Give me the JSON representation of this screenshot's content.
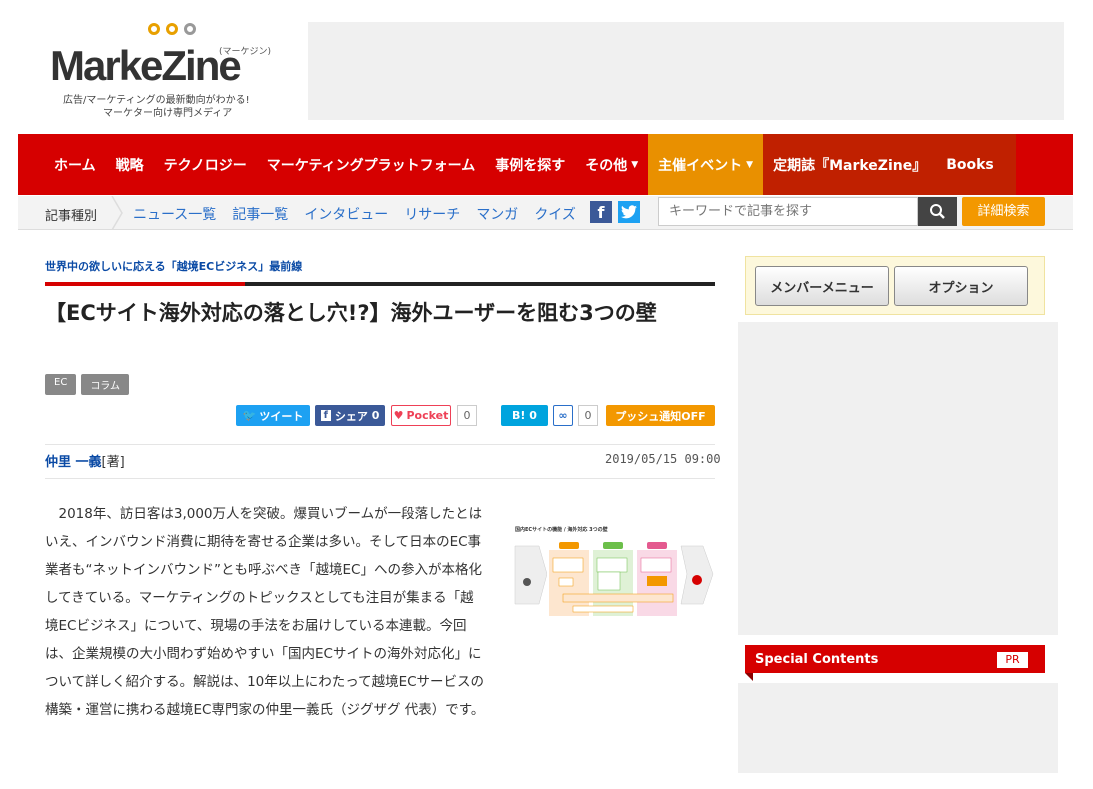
{
  "logo": {
    "main": "MarkeZine",
    "kana": "(マーケジン)",
    "tagline1": "広告/マーケティングの最新動向がわかる!",
    "tagline2": "マーケター向け専門メディア"
  },
  "nav": {
    "items": [
      "ホーム",
      "戦略",
      "テクノロジー",
      "マーケティングプラットフォーム",
      "事例を探す",
      "その他",
      "主催イベント",
      "定期誌『MarkeZine』",
      "Books"
    ]
  },
  "subnav": {
    "label": "記事種別",
    "links": [
      "ニュース一覧",
      "記事一覧",
      "インタビュー",
      "リサーチ",
      "マンガ",
      "クイズ"
    ],
    "search_placeholder": "キーワードで記事を探す",
    "advanced_search": "詳細検索"
  },
  "article": {
    "series": "世界中の欲しいに応える「越境ECビジネス」最前線",
    "title": "【ECサイト海外対応の落とし穴!?】海外ユーザーを阻む3つの壁",
    "tags": [
      "EC",
      "コラム"
    ],
    "author_name": "仲里 一義",
    "author_role": "[著]",
    "date": "2019/05/15 09:00",
    "body": "2018年、訪日客は3,000万人を突破。爆買いブームが一段落したとはいえ、インバウンド消費に期待を寄せる企業は多い。そして日本のEC事業者も“ネットインバウンド”とも呼ぶべき「越境EC」への参入が本格化してきている。マーケティングのトピックスとしても注目が集まる「越境ECビジネス」について、現場の手法をお届けしている本連載。今回は、企業規模の大小問わず始めやすい「国内ECサイトの海外対応化」について詳しく紹介する。解説は、10年以上にわたって越境ECサービスの構築・運営に携わる越境EC専門家の仲里一義氏（ジグザグ 代表）です。",
    "figure_title": "国内ECサイトの機能 / 海外対応 3つの壁"
  },
  "share": {
    "tweet": "ツイート",
    "share": "シェア",
    "share_count": "0",
    "pocket": "Pocket",
    "pocket_count": "0",
    "hatena": "B!",
    "hatena_count": "0",
    "feedly_count": "0",
    "push": "プッシュ通知OFF"
  },
  "sidebar": {
    "member_menu": "メンバーメニュー",
    "options": "オプション",
    "special_title": "Special Contents",
    "pr": "PR"
  },
  "colors": {
    "brand_red": "#d60000",
    "accent_orange": "#f39800",
    "link_blue": "#2a6fc9"
  }
}
